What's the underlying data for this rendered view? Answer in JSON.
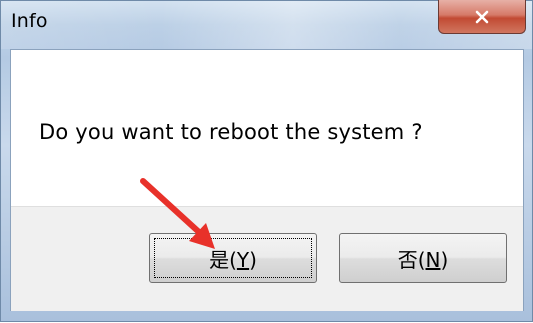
{
  "window": {
    "title": "Info",
    "close_icon": "close-icon"
  },
  "dialog": {
    "message": "Do you want to reboot the system ?"
  },
  "buttons": {
    "yes": {
      "label": "是",
      "accel_prefix": "(",
      "accel": "Y",
      "accel_suffix": ")"
    },
    "no": {
      "label": "否",
      "accel_prefix": "(",
      "accel": "N",
      "accel_suffix": ")"
    }
  },
  "annotation": {
    "arrow_color": "#e8312a",
    "arrow_icon": "red-pointer-arrow"
  },
  "colors": {
    "close_button": "#c8523c",
    "title_bar": "#bcd0e6"
  }
}
